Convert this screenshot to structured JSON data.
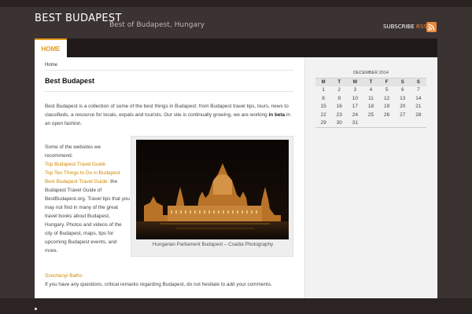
{
  "site": {
    "title": "BEST BUDAPEST",
    "description": "Best of Budapest, Hungary",
    "subscribe_label": "SUBSCRIBE",
    "rss_label": "RSS",
    "accent_color": "#e09a1a"
  },
  "nav": {
    "items": [
      {
        "label": "HOME",
        "active": true
      }
    ]
  },
  "breadcrumb": "Home",
  "page": {
    "title": "Best Budapest",
    "intro_text": "Best Budapest is a collection of some of the best things in Budapest: from Budapest travel tips, tours, news to classifieds, a resource for locals, expats and tourists. Our site is continually growing, we are working",
    "intro_bold": "in beta",
    "intro_tail": "in an open fashion.",
    "websites_intro": "Some of the websites we recommend:",
    "links": [
      "Top Budapest Travel Guide",
      "Top Ten Things to Do in Budapest",
      "Best Budapest Travel Guide:"
    ],
    "guide_desc": "the Budapest Travel Guide of BestBudapest.org. Travel tips that you may not find in many of the great travel books about Budapest, Hungary. Photos and videos of the city of Budapest, maps, tips for upcoming Budapest events, and more.",
    "baths_link": "Szechenyi Baths",
    "closing_text": "If you have any questions, critical remarks regarding Budapest, do not hesitate to add your comments.",
    "image_caption": "Hungarian Parliament Budapest – Csadia Photography"
  },
  "calendar": {
    "caption": "DECEMBER 2014",
    "headers": [
      "M",
      "T",
      "W",
      "T",
      "F",
      "S",
      "S"
    ],
    "weeks": [
      [
        "1",
        "2",
        "3",
        "4",
        "5",
        "6",
        "7"
      ],
      [
        "8",
        "9",
        "10",
        "11",
        "12",
        "13",
        "14"
      ],
      [
        "15",
        "16",
        "17",
        "18",
        "19",
        "20",
        "21"
      ],
      [
        "22",
        "23",
        "24",
        "25",
        "26",
        "27",
        "28"
      ],
      [
        "29",
        "30",
        "31",
        "",
        "",
        "",
        ""
      ]
    ]
  },
  "icons": {
    "rss": "rss-icon"
  }
}
